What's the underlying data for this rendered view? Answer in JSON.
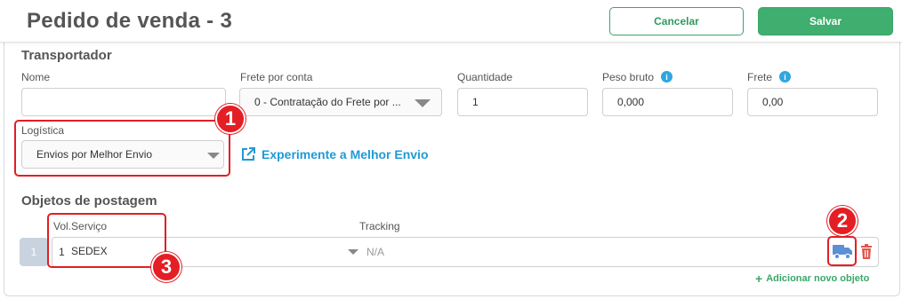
{
  "header": {
    "title": "Pedido de venda - 3",
    "cancel_label": "Cancelar",
    "save_label": "Salvar"
  },
  "transportador": {
    "section_title": "Transportador",
    "nome": {
      "label": "Nome",
      "value": ""
    },
    "frete_por_conta": {
      "label": "Frete por conta",
      "value": "0 - Contratação do Frete por ..."
    },
    "quantidade": {
      "label": "Quantidade",
      "value": "1"
    },
    "peso_bruto": {
      "label": "Peso bruto",
      "value": "0,000",
      "info_icon": "i"
    },
    "frete": {
      "label": "Frete",
      "value": "0,00",
      "info_icon": "i"
    },
    "logistica": {
      "label": "Logística",
      "value": "Envios por Melhor Envio"
    },
    "melhor_envio_link": "Experimente a Melhor Envio"
  },
  "objetos": {
    "section_title": "Objetos de postagem",
    "col_vol_servico": "Vol.Serviço",
    "col_tracking": "Tracking",
    "rows": [
      {
        "num": "1",
        "vol": "1",
        "servico": "SEDEX",
        "tracking": "N/A"
      }
    ],
    "add_label": "Adicionar novo objeto"
  },
  "annotations": {
    "badge1": "1",
    "badge2": "2",
    "badge3": "3"
  },
  "colors": {
    "accent_green": "#3fae6e",
    "link_blue": "#1f9ad6",
    "annotation_red": "#e31e24",
    "delete_red": "#e0574f"
  }
}
